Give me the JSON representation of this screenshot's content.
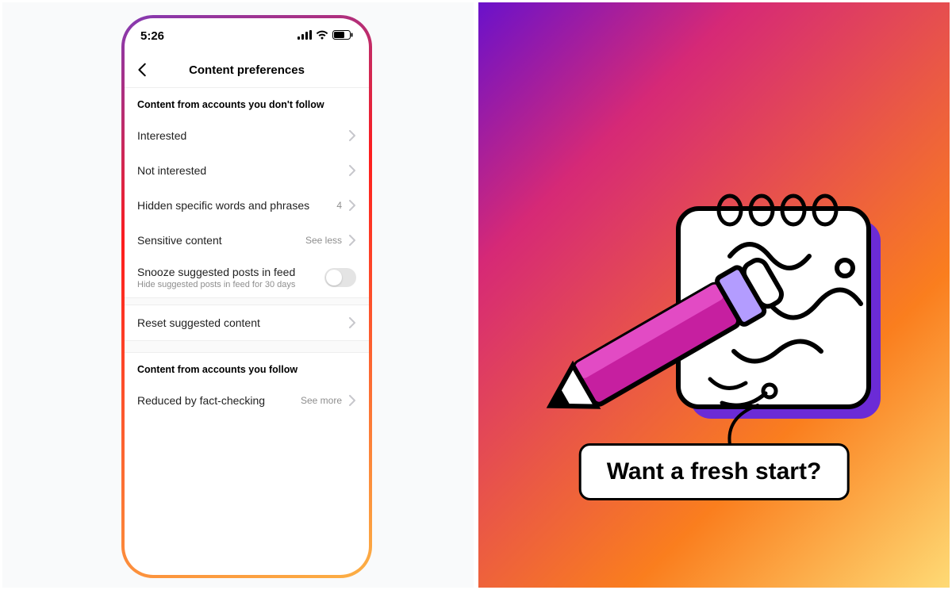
{
  "phone": {
    "status_bar": {
      "time": "5:26"
    },
    "nav": {
      "title": "Content preferences"
    },
    "section1": {
      "title": "Content from accounts you don't follow",
      "items": {
        "interested": {
          "label": "Interested"
        },
        "not_interested": {
          "label": "Not interested"
        },
        "hidden_words": {
          "label": "Hidden specific words and phrases",
          "badge": "4"
        },
        "sensitive": {
          "label": "Sensitive content",
          "trail": "See less"
        },
        "snooze": {
          "label": "Snooze suggested posts in feed",
          "sub": "Hide suggested posts in feed for 30 days",
          "toggle": false
        },
        "reset": {
          "label": "Reset suggested content"
        }
      }
    },
    "section2": {
      "title": "Content from accounts you follow",
      "items": {
        "fact_check": {
          "label": "Reduced by fact-checking",
          "trail": "See more"
        }
      }
    }
  },
  "promo": {
    "bubble_text": "Want a fresh start?"
  }
}
